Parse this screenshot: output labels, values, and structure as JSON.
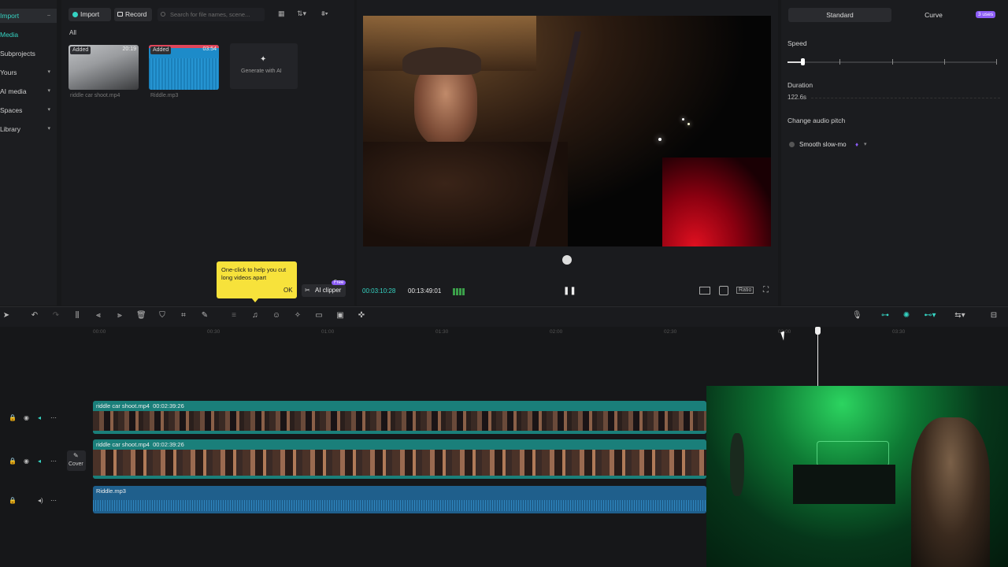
{
  "nav": {
    "items": [
      {
        "label": "Import",
        "active": true
      },
      {
        "label": "Media",
        "selected": true
      },
      {
        "label": "Subprojects"
      },
      {
        "label": "Yours"
      },
      {
        "label": "AI media"
      },
      {
        "label": "Spaces"
      },
      {
        "label": "Library"
      }
    ]
  },
  "media": {
    "import_label": "Import",
    "record_label": "Record",
    "search_placeholder": "Search for file names, scene...",
    "filter_all": "All",
    "items": [
      {
        "badge": "Added",
        "duration": "20:19",
        "name": "riddle car shoot.mp4"
      },
      {
        "badge": "Added",
        "duration": "03:54",
        "name": "Riddle.mp3"
      }
    ],
    "generate_label": "Generate with AI",
    "ai_clipper_label": "AI clipper",
    "ai_clipper_badge": "Free"
  },
  "tooltip": {
    "text": "One-click to help you cut long videos apart",
    "ok": "OK"
  },
  "player": {
    "current_time": "00:03:10:28",
    "total_time": "00:13:49:01",
    "ratio_label": "Ratio"
  },
  "props": {
    "tabs": [
      "Standard",
      "Curve"
    ],
    "uses_badge": "3 uses",
    "speed_label": "Speed",
    "speed_fraction": 0.07,
    "duration_label": "Duration",
    "duration_value": "122.6s",
    "pitch_label": "Change audio pitch",
    "smooth_label": "Smooth slow-mo"
  },
  "timeline": {
    "ruler_ticks": [
      "00:00",
      "00:30",
      "01:00",
      "01:30",
      "02:00",
      "02:30",
      "03:00",
      "03:30"
    ],
    "cover_label": "Cover",
    "clips": [
      {
        "name": "riddle car shoot.mp4",
        "time": "00:02:39:26"
      },
      {
        "name": "riddle car shoot.mp4",
        "time": "00:02:39:26"
      },
      {
        "name": "Riddle.mp3",
        "time": ""
      }
    ]
  },
  "colors": {
    "accent": "#35d3c2",
    "video_clip": "#1e8a84",
    "audio_clip": "#1f5f8c",
    "tooltip": "#f7e23b"
  }
}
